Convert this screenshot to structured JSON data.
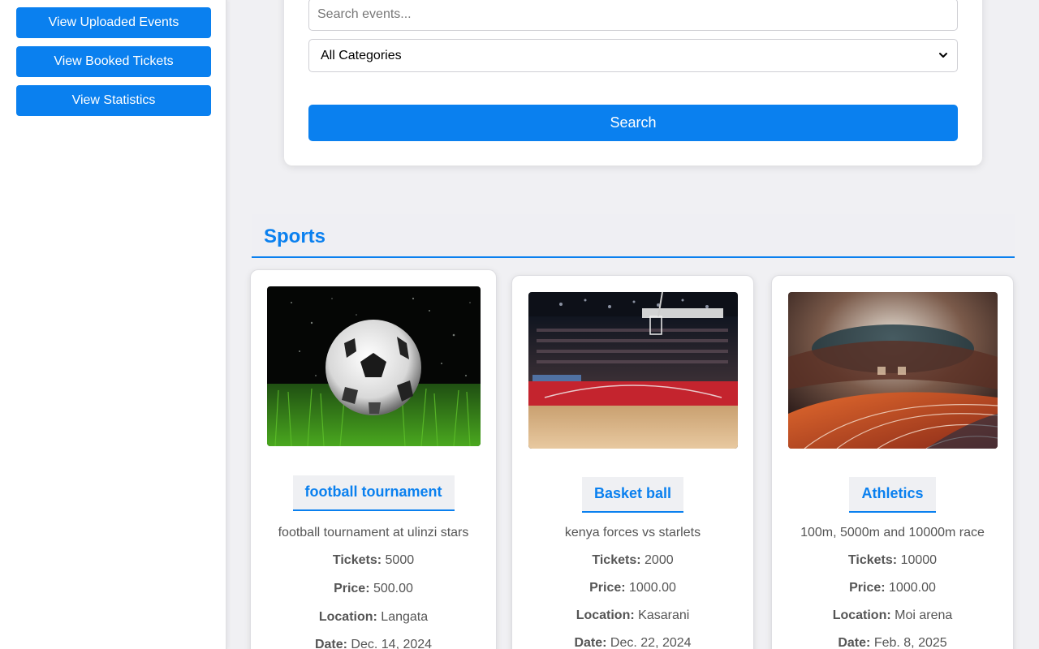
{
  "sidebar": {
    "buttons": [
      {
        "label": "View Uploaded Events"
      },
      {
        "label": "View Booked Tickets"
      },
      {
        "label": "View Statistics"
      }
    ]
  },
  "search": {
    "placeholder": "Search events...",
    "category_value": "All Categories",
    "button_label": "Search"
  },
  "section": {
    "title": "Sports"
  },
  "labels": {
    "tickets": "Tickets:",
    "price": "Price:",
    "location": "Location:",
    "date": "Date:"
  },
  "events": [
    {
      "title": "football tournament",
      "description": "football tournament at ulinzi stars",
      "tickets": "5000",
      "price": "500.00",
      "location": "Langata",
      "date": "Dec. 14, 2024",
      "image": "soccer-ball-on-grass"
    },
    {
      "title": "Basket ball",
      "description": "kenya forces vs starlets",
      "tickets": "2000",
      "price": "1000.00",
      "location": "Kasarani",
      "date": "Dec. 22, 2024",
      "image": "basketball-arena"
    },
    {
      "title": "Athletics",
      "description": "100m, 5000m and 10000m race",
      "tickets": "10000",
      "price": "1000.00",
      "location": "Moi arena",
      "date": "Feb. 8, 2025",
      "image": "athletics-stadium-track"
    }
  ]
}
